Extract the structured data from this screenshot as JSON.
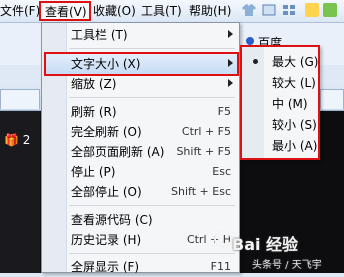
{
  "menubar": {
    "file": "文件(F)",
    "view": "查看(V)",
    "favorites": "收藏(O)",
    "tools": "工具(T)",
    "help": "帮助(H)"
  },
  "background": {
    "baidu": "百度",
    "gift_text": "🎁 2"
  },
  "view_menu": {
    "items": [
      {
        "label": "工具栏 (T)",
        "shortcut": "",
        "submenu": true
      },
      {
        "label": "文字大小 (X)",
        "shortcut": "",
        "submenu": true
      },
      {
        "label": "缩放 (Z)",
        "shortcut": "",
        "submenu": true
      },
      {
        "label": "刷新 (R)",
        "shortcut": "F5"
      },
      {
        "label": "完全刷新 (O)",
        "shortcut": "Ctrl + F5"
      },
      {
        "label": "全部页面刷新 (A)",
        "shortcut": "Shift + F5"
      },
      {
        "label": "停止 (P)",
        "shortcut": "Esc"
      },
      {
        "label": "全部停止 (O)",
        "shortcut": "Shift + Esc"
      },
      {
        "label": "查看源代码 (C)",
        "shortcut": ""
      },
      {
        "label": "历史记录 (H)",
        "shortcut": "Ctrl + H"
      },
      {
        "label": "全屏显示 (F)",
        "shortcut": "F11"
      }
    ]
  },
  "text_size_menu": {
    "items": [
      {
        "label": "最大 (G)",
        "checked": true
      },
      {
        "label": "较大 (L)"
      },
      {
        "label": "中 (M)"
      },
      {
        "label": "较小 (S)"
      },
      {
        "label": "最小 (A)"
      }
    ]
  },
  "watermark": {
    "brand": "Bai 经验",
    "author": "头条号 / 天飞宇"
  }
}
